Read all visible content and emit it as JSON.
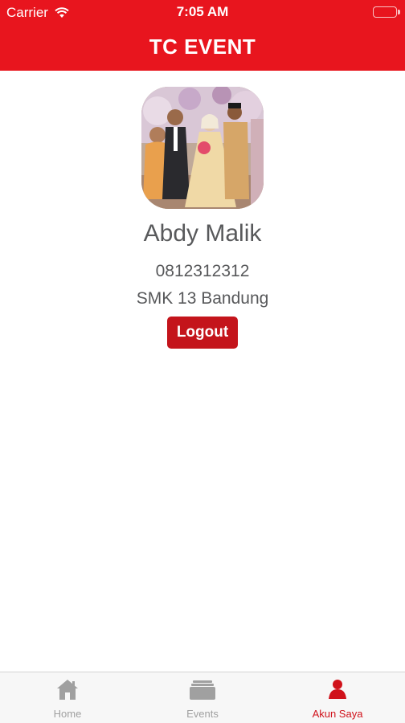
{
  "status_bar": {
    "carrier": "Carrier",
    "time": "7:05 AM"
  },
  "nav": {
    "title": "TC EVENT"
  },
  "profile": {
    "name": "Abdy Malik",
    "phone": "0812312312",
    "school": "SMK 13 Bandung",
    "logout_label": "Logout"
  },
  "tabs": [
    {
      "label": "Home",
      "icon": "home-icon",
      "active": false
    },
    {
      "label": "Events",
      "icon": "events-icon",
      "active": false
    },
    {
      "label": "Akun Saya",
      "icon": "user-icon",
      "active": true
    }
  ],
  "colors": {
    "brand": "#e8151e",
    "button": "#c4141b",
    "text": "#58595b",
    "inactive_tab": "#a0a0a0"
  }
}
